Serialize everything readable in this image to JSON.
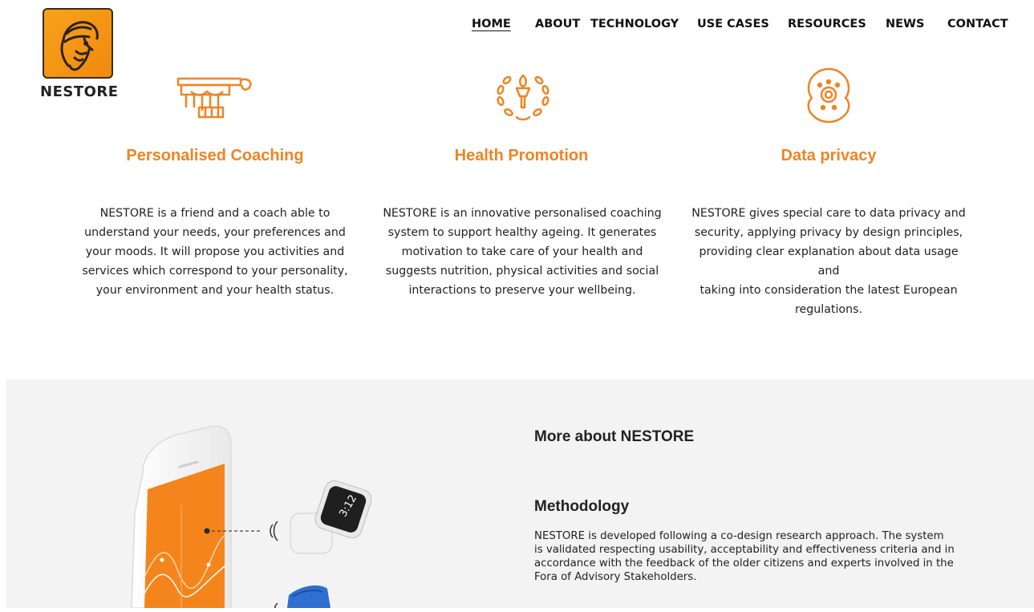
{
  "brand": {
    "logo_text": "NESTORE"
  },
  "nav": {
    "items": [
      "HOME",
      "ABOUT",
      "TECHNOLOGY",
      "USE CASES",
      "RESOURCES",
      "NEWS",
      "CONTACT"
    ],
    "active": "HOME"
  },
  "features": [
    {
      "icon": "column-capital-icon",
      "title": "Personalised Coaching",
      "lines": [
        "NESTORE is a friend and a coach able to",
        "understand your needs, your preferences and",
        "your moods. It will propose you activities and",
        "services which correspond to your personality,",
        "your environment and your health status."
      ]
    },
    {
      "icon": "torch-laurel-icon",
      "title": "Health Promotion",
      "lines": [
        "NESTORE is an innovative personalised coaching",
        "system to support healthy ageing. It generates",
        "motivation to take care of your health and",
        "suggests nutrition, physical activities and social",
        "interactions to preserve your wellbeing."
      ]
    },
    {
      "icon": "shield-eye-icon",
      "title": "Data privacy",
      "lines": [
        "NESTORE gives special care to data privacy and",
        "security, applying privacy by design principles,",
        "providing clear explanation about data usage and",
        "taking into consideration the latest European",
        "regulations."
      ]
    }
  ],
  "more": {
    "heading": "More about NESTORE",
    "method_heading": "Methodology",
    "method_lines": [
      "NESTORE is developed following a co-design research approach. The system",
      "is validated respecting usability, acceptability and effectiveness criteria and in",
      "accordance with the feedback of the older citizens and experts involved in the",
      "Fora of Advisory Stakeholders."
    ]
  },
  "illustration": {
    "watch_time": "3:12"
  },
  "colors": {
    "accent": "#ef8424",
    "section_bg": "#f3f3f3"
  }
}
